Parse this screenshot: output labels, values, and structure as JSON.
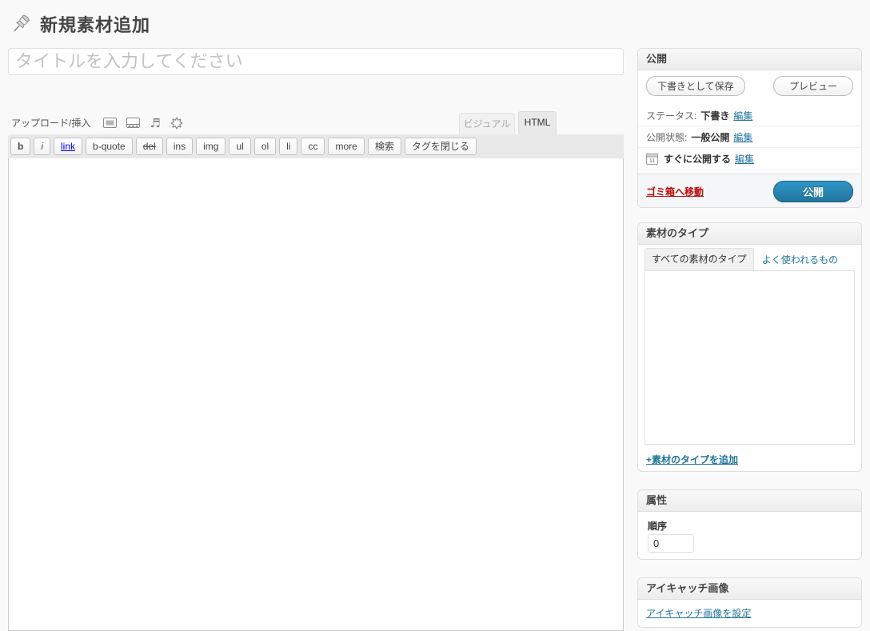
{
  "page": {
    "title": "新規素材追加"
  },
  "editor": {
    "title_placeholder": "タイトルを入力してください",
    "upload_label": "アップロード/挿入",
    "media_icons": [
      "add-image",
      "add-video",
      "add-audio",
      "add-media"
    ],
    "tabs": {
      "visual": "ビジュアル",
      "html": "HTML",
      "active": "HTML"
    },
    "quicktags": [
      "b",
      "i",
      "link",
      "b-quote",
      "del",
      "ins",
      "img",
      "ul",
      "ol",
      "li",
      "cc",
      "more",
      "検索",
      "タグを閉じる"
    ],
    "content": ""
  },
  "publish_box": {
    "title": "公開",
    "save_draft_label": "下書きとして保存",
    "preview_label": "プレビュー",
    "status_label": "ステータス:",
    "status_value": "下書き",
    "visibility_label": "公開状態:",
    "visibility_value": "一般公開",
    "schedule_value": "すぐに公開する",
    "edit_label": "編集",
    "calendar_day": "11",
    "trash_label": "ゴミ箱へ移動",
    "publish_label": "公開",
    "publish_color": "#21759b",
    "trash_color": "#bc0b0b"
  },
  "material_type_box": {
    "title": "素材のタイプ",
    "tab_all": "すべての素材のタイプ",
    "tab_popular": "よく使われるもの",
    "add_link": "+素材のタイプを追加"
  },
  "attributes_box": {
    "title": "属性",
    "order_label": "順序",
    "order_value": "0"
  },
  "featured_image_box": {
    "title": "アイキャッチ画像",
    "set_link": "アイキャッチ画像を設定"
  }
}
